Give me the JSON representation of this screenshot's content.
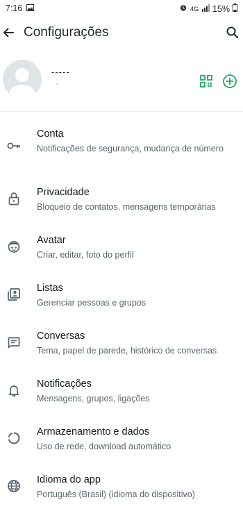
{
  "status_bar": {
    "time": "7:16",
    "network": "4G",
    "battery": "15%"
  },
  "header": {
    "title": "Configurações"
  },
  "profile": {
    "name": "-----",
    "about": "-"
  },
  "menu": [
    {
      "title": "Conta",
      "subtitle": "Notificações de segurança, mudança de número",
      "icon": "key-icon"
    },
    {
      "title": "Privacidade",
      "subtitle": "Bloqueio de contatos, mensagens temporárias",
      "icon": "lock-icon"
    },
    {
      "title": "Avatar",
      "subtitle": "Criar, editar, foto do perfil",
      "icon": "avatar-face-icon"
    },
    {
      "title": "Listas",
      "subtitle": "Gerenciar pessoas e grupos",
      "icon": "contact-list-icon"
    },
    {
      "title": "Conversas",
      "subtitle": "Tema, papel de parede, histórico de conversas",
      "icon": "chat-icon"
    },
    {
      "title": "Notificações",
      "subtitle": "Mensagens, grupos, ligações",
      "icon": "bell-icon"
    },
    {
      "title": "Armazenamento e dados",
      "subtitle": "Uso de rede, download automático",
      "icon": "storage-ring-icon"
    },
    {
      "title": "Idioma do app",
      "subtitle": "Português (Brasil) (idioma do dispositivo)",
      "icon": "globe-icon"
    }
  ],
  "colors": {
    "accent": "#1daa61",
    "icon": "#54656f",
    "subtitle": "#54656f"
  }
}
